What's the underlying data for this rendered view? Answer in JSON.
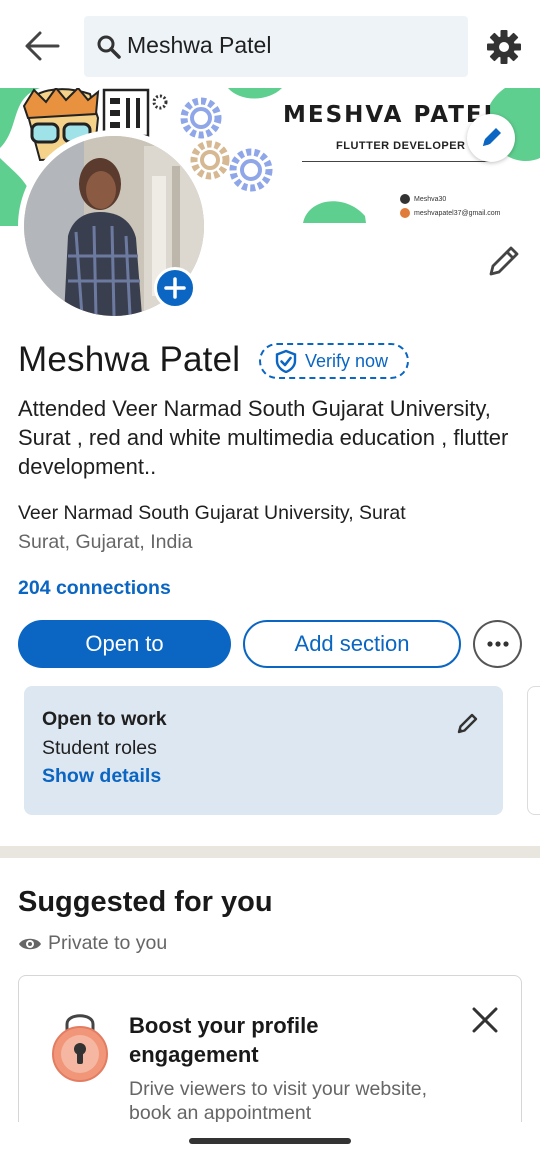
{
  "search": {
    "value": "Meshwa Patel"
  },
  "banner": {
    "title": "MESHVA PATEL",
    "subtitle": "FLUTTER DEVELOPER",
    "github": "Meshva30",
    "email": "meshvapatel37@gmail.com"
  },
  "profile": {
    "name": "Meshwa Patel",
    "verify_label": "Verify now",
    "headline": "Attended Veer Narmad South Gujarat University, Surat , red and white multimedia education , flutter development..",
    "education": "Veer Narmad South Gujarat University, Surat",
    "location": "Surat, Gujarat, India",
    "connections": "204 connections"
  },
  "actions": {
    "open_to": "Open to",
    "add_section": "Add section"
  },
  "open_to_work": {
    "title": "Open to work",
    "roles": "Student roles",
    "details_link": "Show details"
  },
  "suggested": {
    "title": "Suggested for you",
    "privacy": "Private to you",
    "card_title": "Boost your profile engagement",
    "card_desc": "Drive viewers to visit your website, book an appointment"
  },
  "colors": {
    "accent": "#0a66c2",
    "banner_green": "#5fcf8f",
    "card_bg": "#dde7f1"
  },
  "icons": [
    "back-arrow-icon",
    "search-icon",
    "gear-icon",
    "pencil-icon",
    "plus-icon",
    "shield-check-icon",
    "more-icon",
    "eye-icon",
    "lock-icon",
    "close-icon"
  ]
}
